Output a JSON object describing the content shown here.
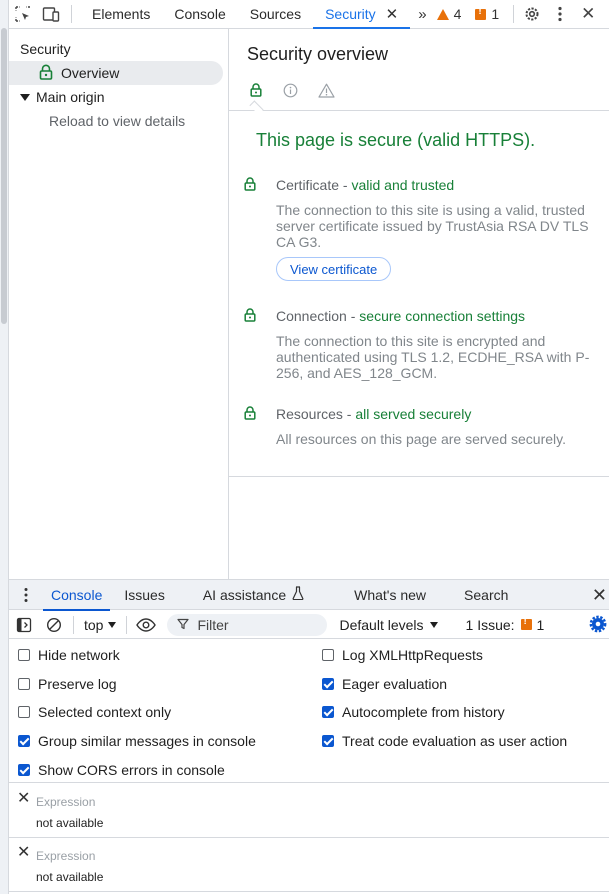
{
  "toolbar": {
    "tabs": [
      {
        "label": "Elements"
      },
      {
        "label": "Console"
      },
      {
        "label": "Sources"
      },
      {
        "label": "Security"
      }
    ],
    "warnings_count": "4",
    "issues_count": "1"
  },
  "sidebar": {
    "title": "Security",
    "overview_label": "Overview",
    "main_origin_label": "Main origin",
    "reload_text": "Reload to view details"
  },
  "main": {
    "title": "Security overview",
    "secure_heading": "This page is secure (valid HTTPS).",
    "sections": [
      {
        "name": "Certificate",
        "sep": " - ",
        "status": "valid and trusted",
        "description": "The connection to this site is using a valid, trusted server certificate issued by TrustAsia RSA DV TLS CA G3."
      },
      {
        "name": "Connection",
        "sep": " - ",
        "status": "secure connection settings",
        "description": "The connection to this site is encrypted and authenticated using TLS 1.2, ECDHE_RSA with P-256, and AES_128_GCM."
      },
      {
        "name": "Resources",
        "sep": " - ",
        "status": "all served securely",
        "description": "All resources on this page are served securely."
      }
    ],
    "view_certificate_label": "View certificate"
  },
  "drawer": {
    "tabs": [
      {
        "label": "Console"
      },
      {
        "label": "Issues"
      },
      {
        "label": "AI assistance"
      },
      {
        "label": "What's new"
      },
      {
        "label": "Search"
      }
    ],
    "console_bar": {
      "context": "top",
      "filter_placeholder": "Filter",
      "levels": "Default levels",
      "issues_label": "1 Issue:",
      "issues_count": "1"
    },
    "settings_left": [
      {
        "label": "Hide network",
        "checked": false
      },
      {
        "label": "Preserve log",
        "checked": false
      },
      {
        "label": "Selected context only",
        "checked": false
      },
      {
        "label": "Group similar messages in console",
        "checked": true
      },
      {
        "label": "Show CORS errors in console",
        "checked": true
      }
    ],
    "settings_right": [
      {
        "label": "Log XMLHttpRequests",
        "checked": false
      },
      {
        "label": "Eager evaluation",
        "checked": true
      },
      {
        "label": "Autocomplete from history",
        "checked": true
      },
      {
        "label": "Treat code evaluation as user action",
        "checked": true
      }
    ],
    "expressions": [
      {
        "label": "Expression",
        "value": "not available"
      },
      {
        "label": "Expression",
        "value": "not available"
      }
    ]
  },
  "colors": {
    "accent": "#1a73e8",
    "secure_green": "#188038",
    "warning_orange": "#e8710a"
  }
}
